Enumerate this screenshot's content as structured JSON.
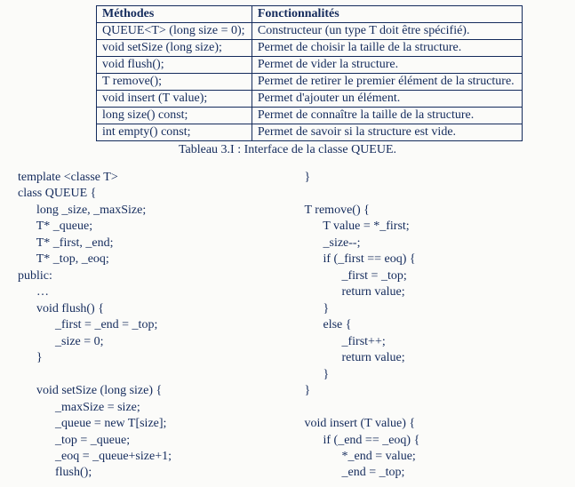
{
  "table": {
    "header": {
      "c0": "Méthodes",
      "c1": "Fonctionnalités"
    },
    "rows": [
      {
        "c0": "QUEUE<T> (long size = 0);",
        "c1": "Constructeur (un type T doit être spécifié)."
      },
      {
        "c0": "void setSize (long size);",
        "c1": "Permet de choisir la taille de la structure."
      },
      {
        "c0": "void flush();",
        "c1": "Permet de vider la structure."
      },
      {
        "c0": "T remove();",
        "c1": "Permet de retirer le premier élément de la structure."
      },
      {
        "c0": "void insert (T value);",
        "c1": "Permet d'ajouter un élément."
      },
      {
        "c0": "long size() const;",
        "c1": "Permet de connaître la taille de la structure."
      },
      {
        "c0": "int empty() const;",
        "c1": "Permet de savoir si la structure est vide."
      }
    ]
  },
  "caption": "Tableau 3.I : Interface de la classe QUEUE.",
  "code": {
    "left": "template <classe T>\nclass QUEUE {\n      long _size, _maxSize;\n      T* _queue;\n      T* _first, _end;\n      T* _top, _eoq;\npublic:\n      …\n      void flush() {\n            _first = _end = _top;\n            _size = 0;\n      }\n\n      void setSize (long size) {\n            _maxSize = size;\n            _queue = new T[size];\n            _top = _queue;\n            _eoq = _queue+size+1;\n            flush();",
    "right": "}\n\nT remove() {\n      T value = *_first;\n      _size--;\n      if (_first == eoq) {\n            _first = _top;\n            return value;\n      }\n      else {\n            _first++;\n            return value;\n      }\n}\n\nvoid insert (T value) {\n      if (_end == _eoq) {\n            *_end = value;\n            _end = _top;"
  }
}
